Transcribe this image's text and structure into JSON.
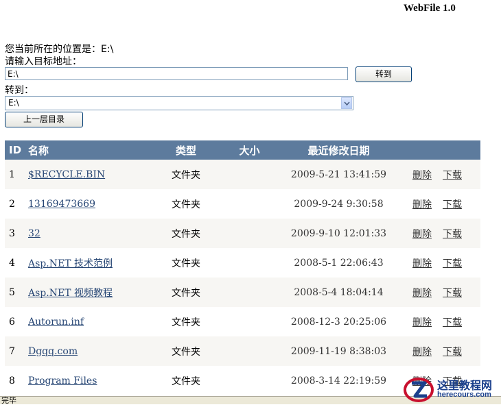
{
  "app": {
    "title": "WebFile 1.0"
  },
  "location": {
    "label": "您当前所在的位置是：",
    "value": "E:\\"
  },
  "target": {
    "label": "请输入目标地址：",
    "value": "E:\\",
    "button": "转到"
  },
  "goto": {
    "label": "转到：",
    "selected": "E:\\"
  },
  "up_button": "上一层目录",
  "table": {
    "headers": [
      "ID",
      "名称",
      "类型",
      "大小",
      "最近修改日期"
    ],
    "delete_label": "删除",
    "download_label": "下载",
    "rows": [
      {
        "id": "1",
        "name": "$RECYCLE.BIN",
        "type": "文件夹",
        "size": "",
        "date": "2009-5-21 13:41:59"
      },
      {
        "id": "2",
        "name": "13169473669",
        "type": "文件夹",
        "size": "",
        "date": "2009-9-24 9:30:58"
      },
      {
        "id": "3",
        "name": "32",
        "type": "文件夹",
        "size": "",
        "date": "2009-9-10 12:01:33"
      },
      {
        "id": "4",
        "name": "Asp.NET 技术范例",
        "type": "文件夹",
        "size": "",
        "date": "2008-5-1 22:06:43"
      },
      {
        "id": "5",
        "name": "Asp.NET 视频教程",
        "type": "文件夹",
        "size": "",
        "date": "2008-5-4 18:04:14"
      },
      {
        "id": "6",
        "name": "Autorun.inf",
        "type": "文件夹",
        "size": "",
        "date": "2008-12-3 20:25:06"
      },
      {
        "id": "7",
        "name": "Dgqq.com",
        "type": "文件夹",
        "size": "",
        "date": "2009-11-19 8:38:03"
      },
      {
        "id": "8",
        "name": "Program Files",
        "type": "文件夹",
        "size": "",
        "date": "2008-3-14 22:19:59"
      }
    ]
  },
  "status": {
    "text": "完毕"
  },
  "watermark": {
    "text": "这里教程网",
    "sub": "herecours.com"
  },
  "colors": {
    "header_bg": "#5d7b9d",
    "alt_row": "#f7f6f3",
    "link": "#284775"
  }
}
